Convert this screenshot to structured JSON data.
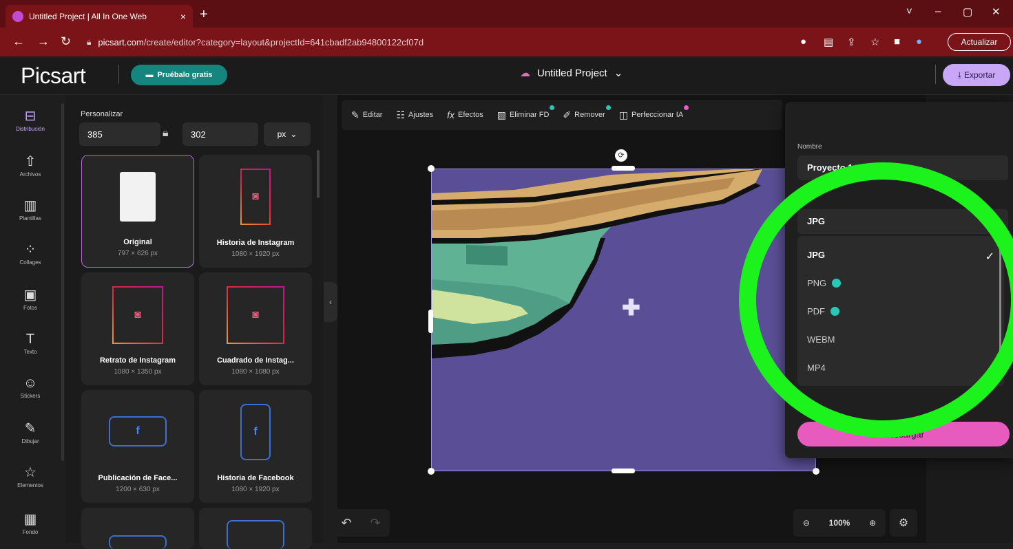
{
  "browser": {
    "tab_title": "Untitled Project | All In One Web",
    "tab_close": "×",
    "new_tab": "+",
    "url_host": "picsart.com",
    "url_path": "/create/editor?category=layout&projectId=641cbadf2ab94800122cf07d",
    "update_label": "Actualizar",
    "window_controls": [
      "˅",
      "–",
      "▢",
      "✕"
    ]
  },
  "header": {
    "logo": "Picsart",
    "try_label": "Pruébalo gratis",
    "project_title": "Untitled Project",
    "export_label": "Exportar"
  },
  "rail": {
    "items": [
      {
        "label": "Distribución",
        "icon": "layout-icon",
        "glyph": "⊟",
        "active": true
      },
      {
        "label": "Archivos",
        "icon": "upload-icon",
        "glyph": "⇧",
        "active": false
      },
      {
        "label": "Plantillas",
        "icon": "templates-icon",
        "glyph": "▥",
        "active": false
      },
      {
        "label": "Collages",
        "icon": "collages-icon",
        "glyph": "⁘",
        "active": false
      },
      {
        "label": "Fotos",
        "icon": "photos-icon",
        "glyph": "▣",
        "active": false
      },
      {
        "label": "Texto",
        "icon": "text-icon",
        "glyph": "T",
        "active": false
      },
      {
        "label": "Stickers",
        "icon": "stickers-icon",
        "glyph": "☺",
        "active": false
      },
      {
        "label": "Dibujar",
        "icon": "brush-icon",
        "glyph": "✎",
        "active": false
      },
      {
        "label": "Elementos",
        "icon": "star-icon",
        "glyph": "☆",
        "active": false
      },
      {
        "label": "Fondo",
        "icon": "background-icon",
        "glyph": "▦",
        "active": false
      }
    ]
  },
  "panel": {
    "title": "Personalizar",
    "width": "385",
    "height": "302",
    "unit": "px",
    "cards": [
      {
        "name": "Original",
        "size": "797 × 626 px"
      },
      {
        "name": "Historia de Instagram",
        "size": "1080 × 1920 px"
      },
      {
        "name": "Retrato de Instagram",
        "size": "1080 × 1350 px"
      },
      {
        "name": "Cuadrado de Instag...",
        "size": "1080 × 1080 px"
      },
      {
        "name": "Publicación de Face...",
        "size": "1200 × 630 px"
      },
      {
        "name": "Historia de Facebook",
        "size": "1080 × 1920 px"
      }
    ]
  },
  "toolbar": {
    "items": [
      "Editar",
      "Ajustes",
      "Efectos",
      "Eliminar FD",
      "Remover",
      "Perfeccionar IA"
    ]
  },
  "zoom": {
    "level": "100%"
  },
  "export_panel": {
    "name_label": "Nombre",
    "name_value": "Proyecto 1",
    "format_value": "JPG",
    "options": [
      "JPG",
      "PNG",
      "PDF",
      "WEBM",
      "MP4"
    ],
    "selected": "JPG",
    "download_label": "Descargar"
  },
  "colors": {
    "accent_purple": "#c8a7f7",
    "teal": "#16857d",
    "browser_red": "#7a1418",
    "canvas_bg": "#5a4f96",
    "annotation_green": "#1cf21c",
    "download_pink": "#e75bbf"
  }
}
